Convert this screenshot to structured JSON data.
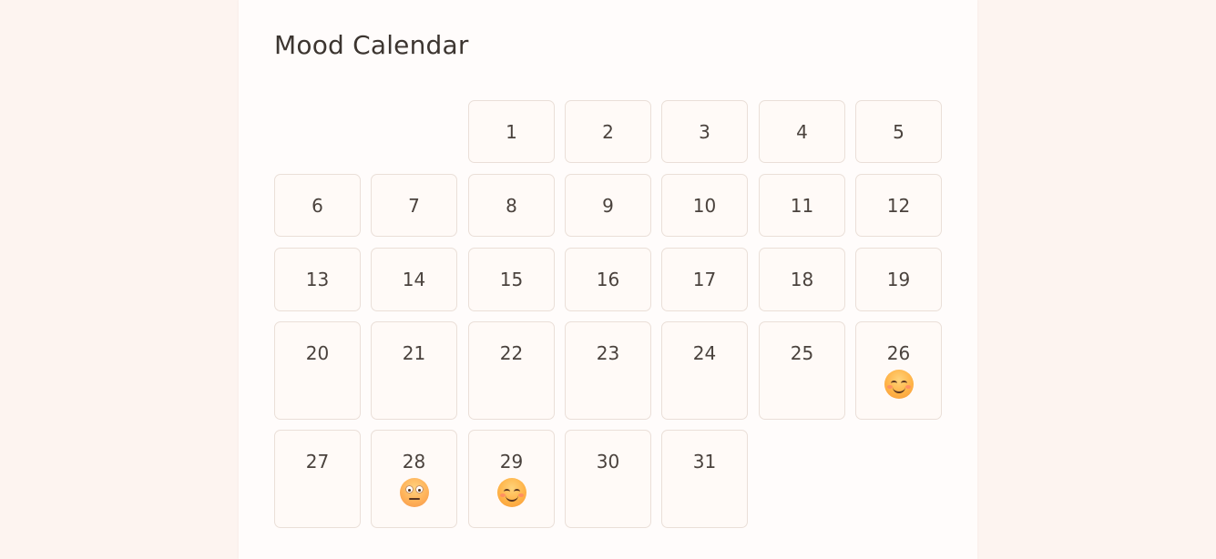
{
  "title": "Mood Calendar",
  "days": [
    {
      "day": "1",
      "mood": null
    },
    {
      "day": "2",
      "mood": null
    },
    {
      "day": "3",
      "mood": null
    },
    {
      "day": "4",
      "mood": null
    },
    {
      "day": "5",
      "mood": null
    },
    {
      "day": "6",
      "mood": null
    },
    {
      "day": "7",
      "mood": null
    },
    {
      "day": "8",
      "mood": null
    },
    {
      "day": "9",
      "mood": null
    },
    {
      "day": "10",
      "mood": null
    },
    {
      "day": "11",
      "mood": null
    },
    {
      "day": "12",
      "mood": null
    },
    {
      "day": "13",
      "mood": null
    },
    {
      "day": "14",
      "mood": null
    },
    {
      "day": "15",
      "mood": null
    },
    {
      "day": "16",
      "mood": null
    },
    {
      "day": "17",
      "mood": null
    },
    {
      "day": "18",
      "mood": null
    },
    {
      "day": "19",
      "mood": null
    },
    {
      "day": "20",
      "mood": null
    },
    {
      "day": "21",
      "mood": null
    },
    {
      "day": "22",
      "mood": null
    },
    {
      "day": "23",
      "mood": null
    },
    {
      "day": "24",
      "mood": null
    },
    {
      "day": "25",
      "mood": null
    },
    {
      "day": "26",
      "mood": "smiling-face-icon"
    },
    {
      "day": "27",
      "mood": null
    },
    {
      "day": "28",
      "mood": "neutral-face-icon"
    },
    {
      "day": "29",
      "mood": "smiling-face-icon"
    },
    {
      "day": "30",
      "mood": null
    },
    {
      "day": "31",
      "mood": null
    }
  ],
  "colors": {
    "background": "#fdf4f0",
    "card": "#fffcfb",
    "cell_border": "#eadfd8",
    "text": "#3c3530"
  }
}
